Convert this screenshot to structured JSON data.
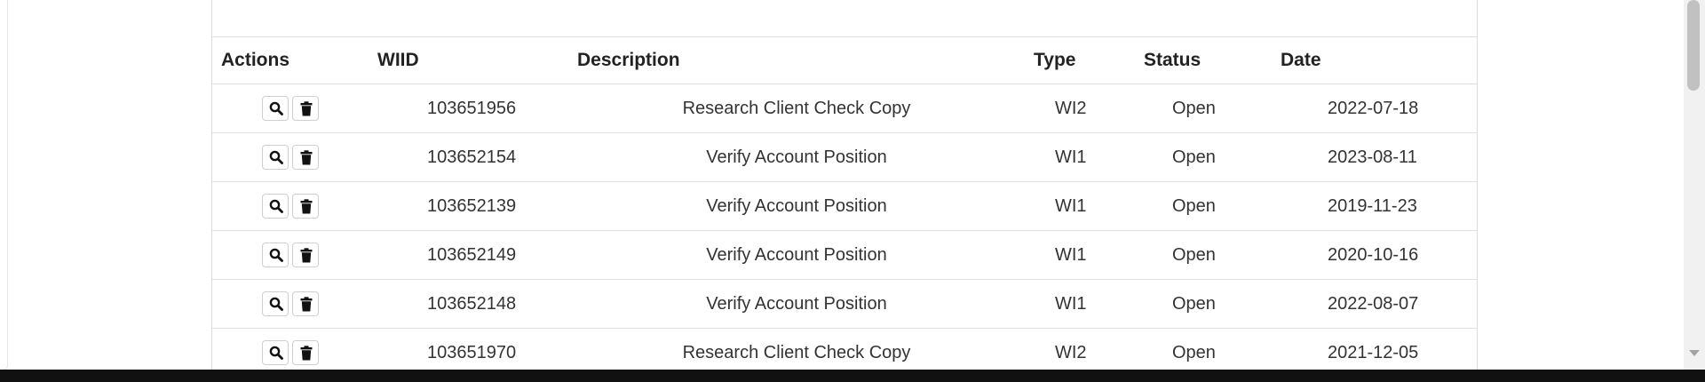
{
  "table": {
    "headers": {
      "actions": "Actions",
      "wiid": "WIID",
      "description": "Description",
      "type": "Type",
      "status": "Status",
      "date": "Date"
    },
    "rows": [
      {
        "wiid": "103651956",
        "description": "Research Client Check Copy",
        "type": "WI2",
        "status": "Open",
        "date": "2022-07-18"
      },
      {
        "wiid": "103652154",
        "description": "Verify Account Position",
        "type": "WI1",
        "status": "Open",
        "date": "2023-08-11"
      },
      {
        "wiid": "103652139",
        "description": "Verify Account Position",
        "type": "WI1",
        "status": "Open",
        "date": "2019-11-23"
      },
      {
        "wiid": "103652149",
        "description": "Verify Account Position",
        "type": "WI1",
        "status": "Open",
        "date": "2020-10-16"
      },
      {
        "wiid": "103652148",
        "description": "Verify Account Position",
        "type": "WI1",
        "status": "Open",
        "date": "2022-08-07"
      },
      {
        "wiid": "103651970",
        "description": "Research Client Check Copy",
        "type": "WI2",
        "status": "Open",
        "date": "2021-12-05"
      }
    ]
  },
  "icons": {
    "view": "magnifier-icon",
    "delete": "trash-icon"
  }
}
